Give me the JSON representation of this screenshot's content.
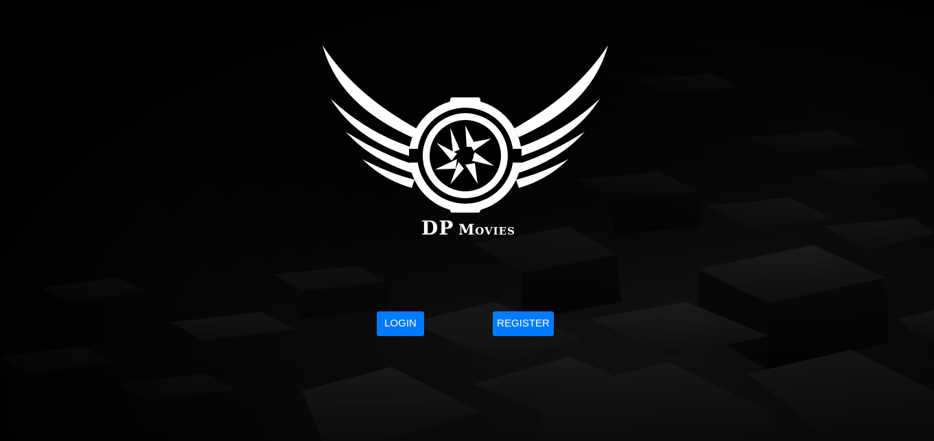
{
  "brand": {
    "name_prefix": "DP",
    "name_suffix": "Movies"
  },
  "actions": {
    "login_label": "LOGIN",
    "register_label": "REGISTER"
  },
  "colors": {
    "background": "#000000",
    "button": "#007bff",
    "button_text": "#ffffff",
    "logo": "#ffffff"
  },
  "icons": {
    "logo": "winged-camera-aperture-logo"
  }
}
